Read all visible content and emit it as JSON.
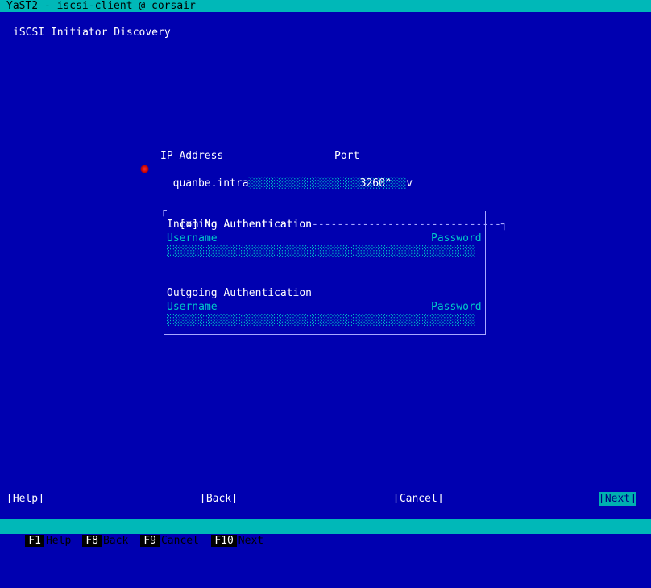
{
  "window": {
    "title": "YaST2 - iscsi-client @ corsair"
  },
  "dialog": {
    "heading": "iSCSI Initiator Discovery"
  },
  "form": {
    "ip_label": "IP Address",
    "port_label": "Port",
    "ip_value": "quanbe.intra",
    "port_value": "3260"
  },
  "auth": {
    "no_auth_checkbox": "[x] No Authentication",
    "incoming_label": "Incoming Authentication",
    "outgoing_label": "Outgoing Authentication",
    "username_label": "Username",
    "password_label": "Password"
  },
  "buttons": {
    "help": "[Help]",
    "back": "[Back]",
    "cancel": "[Cancel]",
    "next": "[Next]"
  },
  "function_keys": [
    {
      "key": "F1",
      "label": "Help"
    },
    {
      "key": "F8",
      "label": "Back"
    },
    {
      "key": "F9",
      "label": "Cancel"
    },
    {
      "key": "F10",
      "label": "Next"
    }
  ],
  "colors": {
    "background": "#0000b0",
    "accent": "#00b8b8"
  }
}
